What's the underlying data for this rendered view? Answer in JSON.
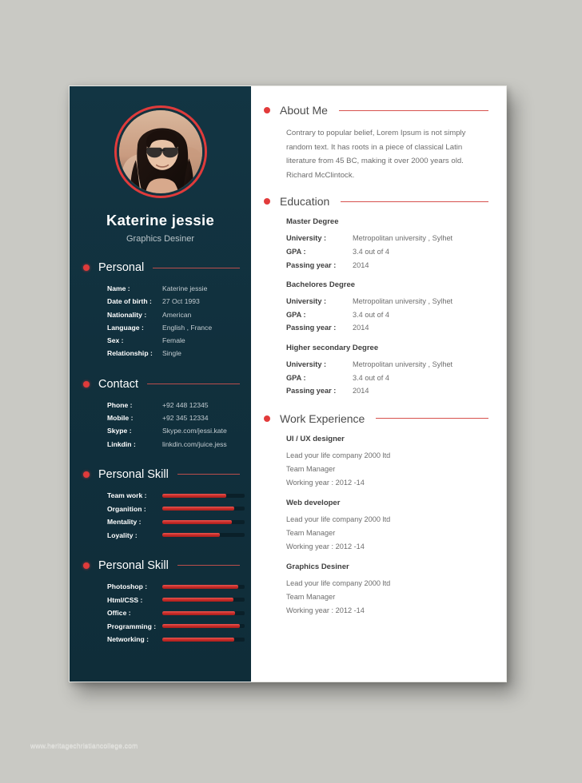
{
  "document": {
    "type": "resume-template",
    "watermark": "www.heritagechristiancollege.com"
  },
  "colors": {
    "dark_panel": "#12323f",
    "accent_red": "#e03b3b",
    "bar_red": "#c62b28",
    "page_background": "#c9c9c4",
    "heading_gray": "#4c4c4c",
    "body_gray": "#6d6d6d"
  },
  "profile": {
    "name": "Katerine jessie",
    "role": "Graphics Desiner",
    "photo_alt": "portrait of woman wearing sunglasses"
  },
  "personal": {
    "heading": "Personal",
    "rows": [
      {
        "label": "Name :",
        "value": "Katerine jessie"
      },
      {
        "label": "Date of birth :",
        "value": "27 Oct 1993"
      },
      {
        "label": "Nationality :",
        "value": "American"
      },
      {
        "label": "Language :",
        "value": "English , France"
      },
      {
        "label": "Sex :",
        "value": "Female"
      },
      {
        "label": "Relationship :",
        "value": "Single"
      }
    ]
  },
  "contact": {
    "heading": "Contact",
    "rows": [
      {
        "label": "Phone :",
        "value": "+92 448 12345"
      },
      {
        "label": "Mobile :",
        "value": "+92 345 12334"
      },
      {
        "label": "Skype :",
        "value": "Skype.com/jessi.kate"
      },
      {
        "label": "Linkdin :",
        "value": "linkdin.com/juice.jess"
      }
    ]
  },
  "skills_primary": {
    "heading": "Personal Skill",
    "rows": [
      {
        "label": "Team work :",
        "percent": 78
      },
      {
        "label": "Organition :",
        "percent": 87
      },
      {
        "label": "Mentality :",
        "percent": 84
      },
      {
        "label": "Loyality :",
        "percent": 70
      }
    ]
  },
  "skills_secondary": {
    "heading": "Personal Skill",
    "rows": [
      {
        "label": "Photoshop :",
        "percent": 92
      },
      {
        "label": "Html/CSS :",
        "percent": 86
      },
      {
        "label": "Office :",
        "percent": 88
      },
      {
        "label": "Programming :",
        "percent": 94
      },
      {
        "label": "Networking :",
        "percent": 87
      }
    ]
  },
  "about": {
    "heading": "About Me",
    "text": "Contrary to popular belief, Lorem Ipsum is not simply random text. It has roots in a piece of classical Latin literature from 45 BC, making it over 2000 years old. Richard McClintock."
  },
  "education": {
    "heading": "Education",
    "entries": [
      {
        "degree": "Master Degree",
        "rows": [
          {
            "label": "University :",
            "value": "Metropolitan university , Sylhet"
          },
          {
            "label": "GPA :",
            "value": "3.4 out of 4"
          },
          {
            "label": "Passing year :",
            "value": "2014"
          }
        ]
      },
      {
        "degree": "Bachelores Degree",
        "rows": [
          {
            "label": "University :",
            "value": "Metropolitan university , Sylhet"
          },
          {
            "label": "GPA :",
            "value": "3.4 out of 4"
          },
          {
            "label": "Passing year :",
            "value": "2014"
          }
        ]
      },
      {
        "degree": "Higher secondary Degree",
        "rows": [
          {
            "label": "University :",
            "value": "Metropolitan university , Sylhet"
          },
          {
            "label": "GPA :",
            "value": "3.4 out of 4"
          },
          {
            "label": "Passing year :",
            "value": "2014"
          }
        ]
      }
    ]
  },
  "work": {
    "heading": "Work Experience",
    "entries": [
      {
        "title": "UI / UX designer",
        "company": "Lead your life company 2000 ltd",
        "position": "Team Manager",
        "years": "Working year : 2012 -14"
      },
      {
        "title": "Web developer",
        "company": "Lead your life company 2000 ltd",
        "position": "Team Manager",
        "years": "Working year : 2012 -14"
      },
      {
        "title": "Graphics Desiner",
        "company": "Lead your life company 2000 ltd",
        "position": "Team Manager",
        "years": "Working year : 2012 -14"
      }
    ]
  }
}
